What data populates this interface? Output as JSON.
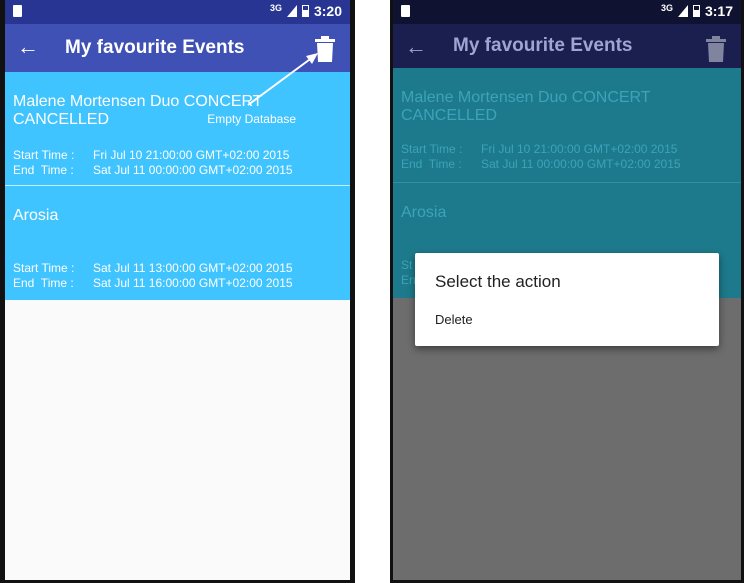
{
  "left": {
    "status_time": "3:20",
    "signal": "3G",
    "title": "My favourite Events",
    "annotation": "Empty Database",
    "events": [
      {
        "name": "Malene Mortensen Duo CONCERT CANCELLED",
        "start_label": "Start Time :",
        "start": "Fri Jul 10 21:00:00 GMT+02:00 2015",
        "end_label": "End  Time :",
        "end": "Sat Jul 11 00:00:00 GMT+02:00 2015"
      },
      {
        "name": "Arosia",
        "start_label": "Start Time :",
        "start": "Sat Jul 11 13:00:00 GMT+02:00 2015",
        "end_label": "End  Time :",
        "end": "Sat Jul 11 16:00:00 GMT+02:00 2015"
      }
    ]
  },
  "right": {
    "status_time": "3:17",
    "signal": "3G",
    "title": "My favourite Events",
    "events": [
      {
        "name": "Malene Mortensen Duo CONCERT CANCELLED",
        "start_label": "Start Time :",
        "start": "Fri Jul 10 21:00:00 GMT+02:00 2015",
        "end_label": "End  Time :",
        "end": "Sat Jul 11 00:00:00 GMT+02:00 2015"
      },
      {
        "name": "Arosia",
        "start_label": "St",
        "end_label": "En"
      }
    ],
    "dialog": {
      "title": "Select the action",
      "item": "Delete"
    }
  },
  "icons": {
    "back": "arrow-left-icon",
    "trash": "trash-icon",
    "sd": "sd-card-icon",
    "signal": "signal-icon",
    "battery": "battery-icon"
  },
  "colors": {
    "primary": "#3f51b5",
    "primary_dark": "#283593",
    "list_bg": "#40c4ff"
  }
}
